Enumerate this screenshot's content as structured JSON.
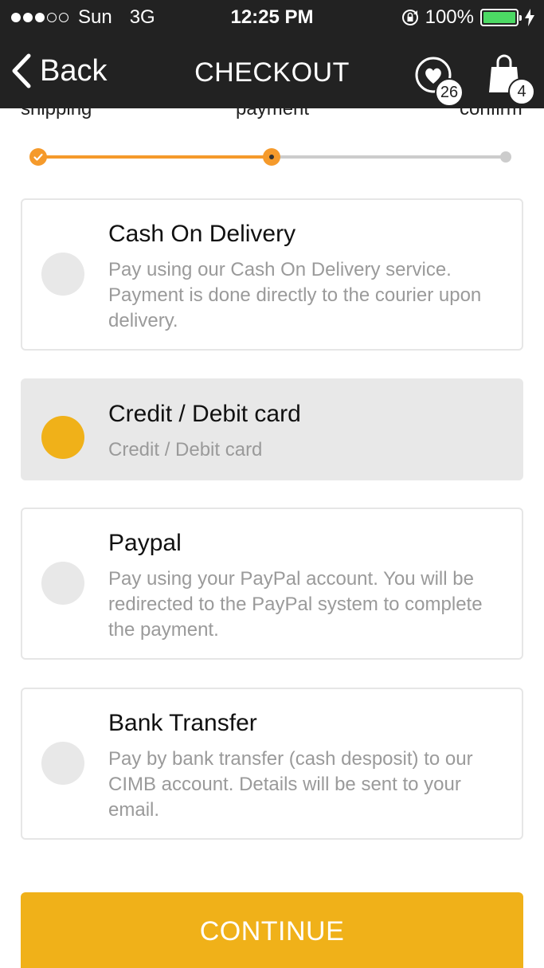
{
  "status_bar": {
    "carrier": "Sun",
    "network": "3G",
    "time": "12:25 PM",
    "battery": "100%",
    "signal_dots_filled": 3,
    "signal_dots_total": 5
  },
  "nav": {
    "back_label": "Back",
    "title": "CHECKOUT",
    "wishlist_count": "26",
    "cart_count": "4"
  },
  "steps": {
    "labels": [
      "shipping",
      "payment",
      "confirm"
    ],
    "current": 1
  },
  "payment_options": [
    {
      "title": "Cash On Delivery",
      "description": "Pay using our Cash On Delivery service. Payment is done directly to the courier upon delivery.",
      "selected": false
    },
    {
      "title": "Credit / Debit card",
      "description": "Credit / Debit card",
      "selected": true
    },
    {
      "title": "Paypal",
      "description": "Pay using your PayPal account. You will be redirected to the PayPal system to complete the payment.",
      "selected": false
    },
    {
      "title": "Bank Transfer",
      "description": "Pay by bank transfer (cash desposit) to our CIMB account. Details will be sent to your email.",
      "selected": false
    }
  ],
  "continue_label": "CONTINUE",
  "colors": {
    "accent": "#f0b119",
    "progress": "#f59a2b",
    "header": "#222222",
    "battery": "#4cd964"
  }
}
